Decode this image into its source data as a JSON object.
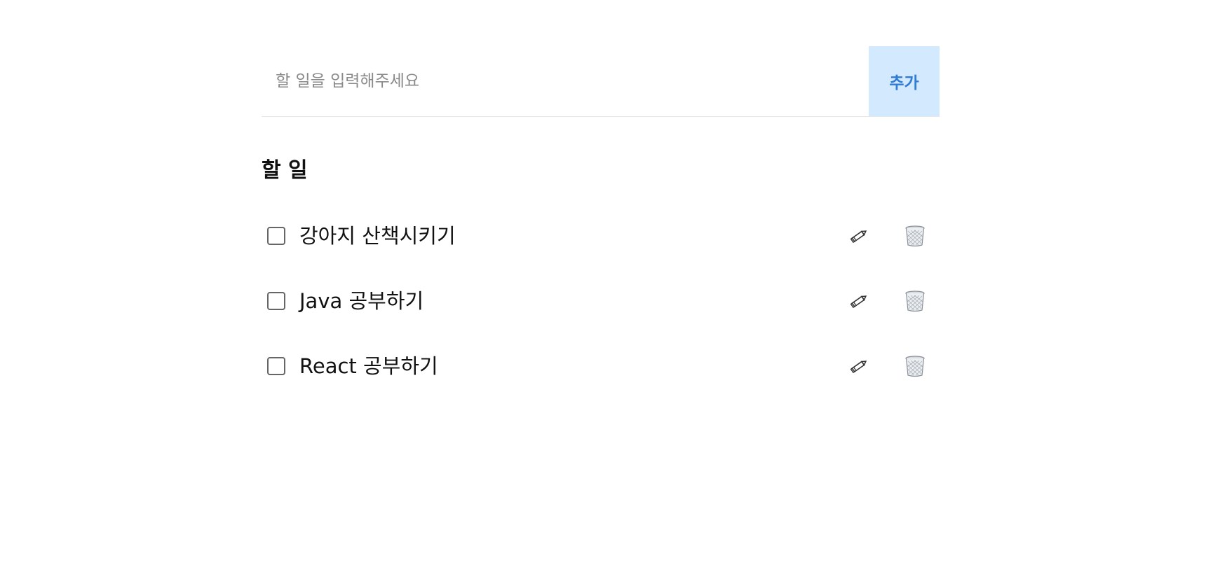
{
  "input": {
    "value": "",
    "placeholder": "할 일을 입력해주세요"
  },
  "add_button": {
    "label": "추가"
  },
  "section": {
    "title": "할 일"
  },
  "todos": [
    {
      "text": "강아지 산책시키기",
      "done": false
    },
    {
      "text": "Java 공부하기",
      "done": false
    },
    {
      "text": "React 공부하기",
      "done": false
    }
  ],
  "icons": {
    "edit": "pencil-icon",
    "delete": "trash-icon"
  },
  "colors": {
    "accent": "#2f7bd6",
    "accent_bg": "#d3e9fd"
  }
}
